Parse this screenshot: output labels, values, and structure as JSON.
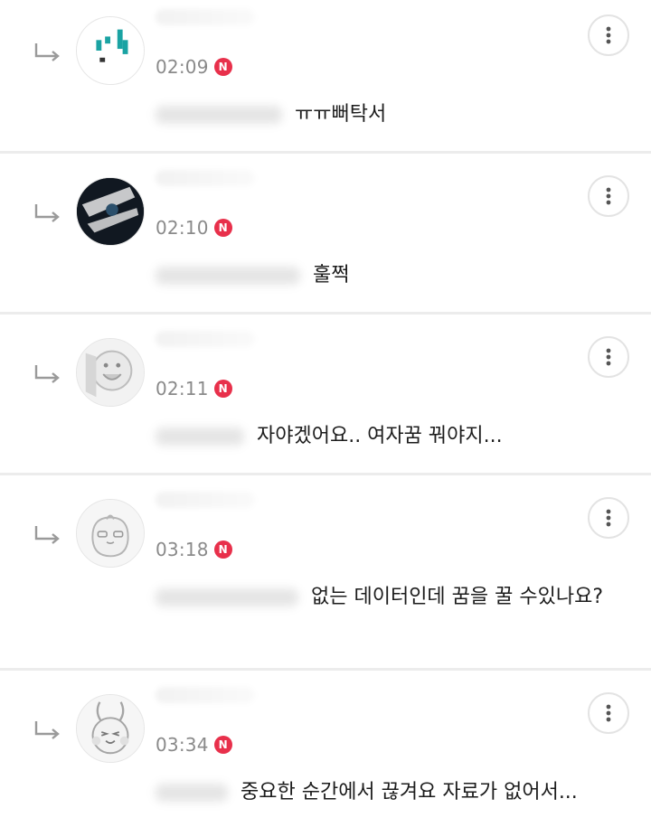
{
  "comments": [
    {
      "time": "02:09",
      "badge": "N",
      "text": "ㅠㅠ뻐탁서",
      "avatar": "teal-blocks-avatar"
    },
    {
      "time": "02:10",
      "badge": "N",
      "text": "훌쩍",
      "avatar": "dark-abstract-avatar"
    },
    {
      "time": "02:11",
      "badge": "N",
      "text": "자야겠어요.. 여자꿈 꿔야지...",
      "avatar": "smiling-face-avatar"
    },
    {
      "time": "03:18",
      "badge": "N",
      "text": "없는 데이터인데 꿈을 꿀 수있나요?",
      "avatar": "apeach-avatar"
    },
    {
      "time": "03:34",
      "badge": "N",
      "text": "중요한 순간에서 끊겨요 자료가 없어서...",
      "avatar": "bunny-avatar"
    }
  ],
  "icons": {
    "reply": "reply-arrow-icon",
    "more": "more-vertical-icon"
  },
  "colors": {
    "badge": "#e8304b",
    "time": "#8a8a8a",
    "text": "#1c1c1c",
    "divider": "#ececec"
  }
}
